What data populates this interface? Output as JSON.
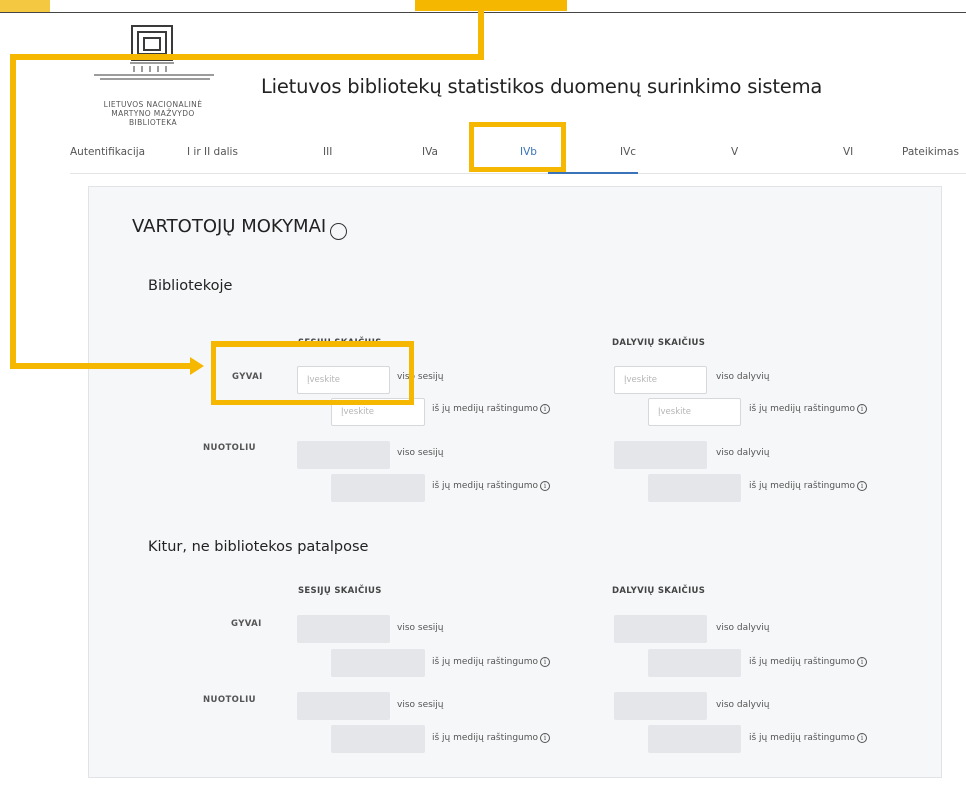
{
  "site": {
    "logo_text": [
      "LIETUVOS NACIONALINĖ",
      "MARTYNO MAŽVYDO",
      "BIBLIOTEKA"
    ],
    "title": "Lietuvos bibliotekų statistikos duomenų surinkimo sistema"
  },
  "nav": {
    "items": [
      {
        "label": "Autentifikacija"
      },
      {
        "label": "I ir II dalis"
      },
      {
        "label": "III"
      },
      {
        "label": "IVa"
      },
      {
        "label": "IVb"
      },
      {
        "label": "IVc"
      },
      {
        "label": "V"
      },
      {
        "label": "VI"
      },
      {
        "label": "Pateikimas"
      }
    ],
    "active": "IVb"
  },
  "panel": {
    "title": "VARTOTOJŲ MOKYMAI",
    "info_glyph": "ⓘ",
    "sections": [
      {
        "title": "Bibliotekoje",
        "col_sessions": "SESIJŲ SKAIČIUS",
        "col_participants": "DALYVIŲ SKAIČIUS",
        "rows": [
          {
            "label": "GYVAI",
            "total_sessions_label": "viso sesijų",
            "media_label": "iš jų medijų raštingumo",
            "total_part_label": "viso dalyvių",
            "placeholder": "Įveskite"
          },
          {
            "label": "NUOTOLIU",
            "total_sessions_label": "viso sesijų",
            "media_label": "iš jų medijų raštingumo",
            "total_part_label": "viso dalyvių",
            "placeholder": ""
          }
        ]
      },
      {
        "title": "Kitur, ne bibliotekos patalpose",
        "col_sessions": "SESIJŲ SKAIČIUS",
        "col_participants": "DALYVIŲ SKAIČIUS",
        "rows": [
          {
            "label": "GYVAI",
            "total_sessions_label": "viso sesijų",
            "media_label": "iš jų medijų raštingumo",
            "total_part_label": "viso dalyvių",
            "placeholder": ""
          },
          {
            "label": "NUOTOLIU",
            "total_sessions_label": "viso sesijų",
            "media_label": "iš jų medijų raštingumo",
            "total_part_label": "viso dalyvių",
            "placeholder": ""
          }
        ]
      }
    ]
  },
  "colors": {
    "annotation": "#f5b700",
    "active_tab": "#3a73b8"
  }
}
